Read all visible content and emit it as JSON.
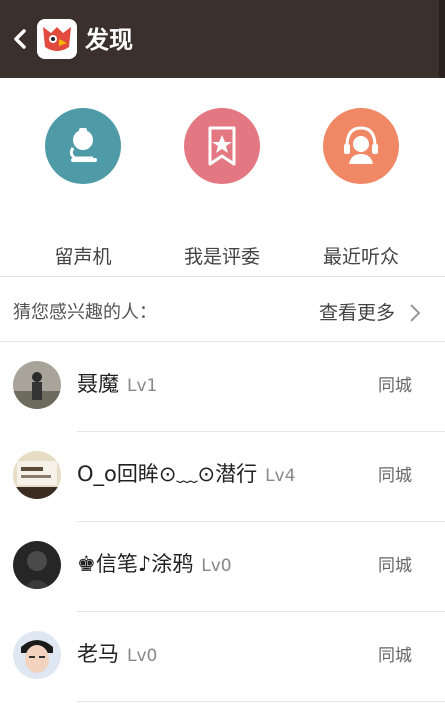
{
  "header": {
    "title": "发现"
  },
  "features": [
    {
      "label": "留声机",
      "icon": "microscope-icon",
      "color": "#4e9aa6"
    },
    {
      "label": "我是评委",
      "icon": "ribbon-star-icon",
      "color": "#e37882"
    },
    {
      "label": "最近听众",
      "icon": "headset-user-icon",
      "color": "#f08866"
    }
  ],
  "interest": {
    "title": "猜您感兴趣的人：",
    "more_label": "查看更多"
  },
  "users": [
    {
      "name": "聂魔",
      "level": "Lv1",
      "location": "同城"
    },
    {
      "name": "O_o回眸⊙﹏⊙潜行",
      "level": "Lv4",
      "location": "同城"
    },
    {
      "name": "♚信笔♪涂鸦",
      "level": "Lv0",
      "location": "同城"
    },
    {
      "name": "老马",
      "level": "Lv0",
      "location": "同城"
    }
  ]
}
